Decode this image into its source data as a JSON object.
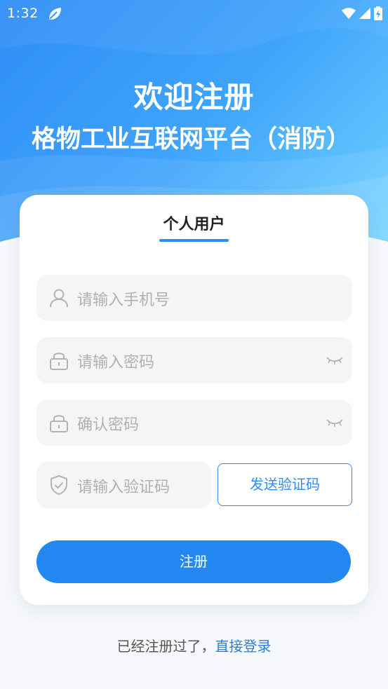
{
  "status_bar": {
    "time": "1:32"
  },
  "header": {
    "title": "欢迎注册",
    "subtitle": "格物工业互联网平台（消防）"
  },
  "card": {
    "tab_label": "个人用户",
    "phone_placeholder": "请输入手机号",
    "password_placeholder": "请输入密码",
    "confirm_placeholder": "确认密码",
    "code_placeholder": "请输入验证码",
    "send_code_label": "发送验证码",
    "register_label": "注册"
  },
  "footer": {
    "prompt": "已经注册过了，",
    "login_link": "直接登录"
  },
  "colors": {
    "accent": "#2388f1",
    "header_start": "#2e8df6",
    "header_end": "#6fd3ff"
  },
  "icons": [
    "leaf-icon",
    "wifi-icon",
    "signal-icon",
    "battery-icon",
    "user-icon",
    "lock-icon",
    "eye-closed-icon",
    "shield-check-icon"
  ]
}
